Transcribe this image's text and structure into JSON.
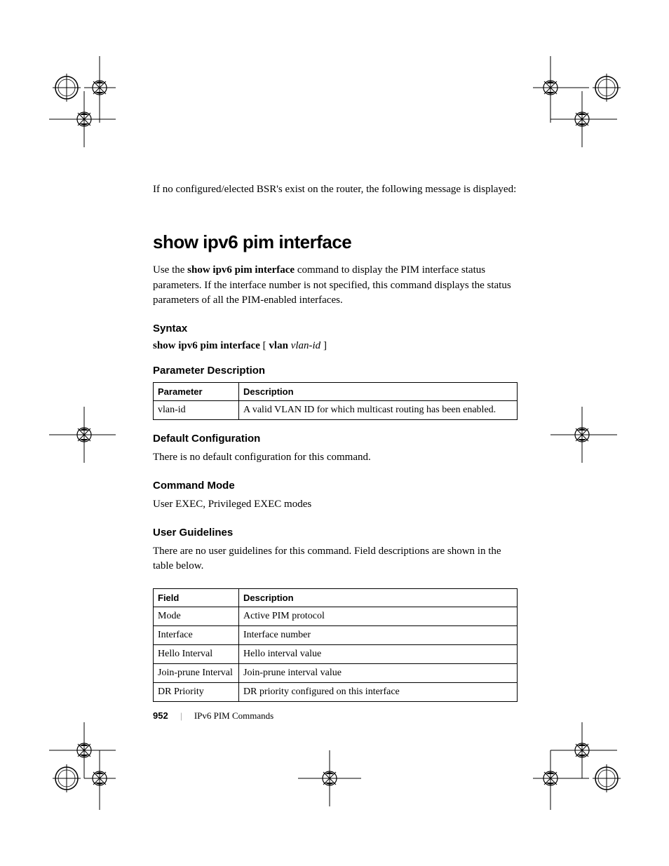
{
  "intro": "If no configured/elected BSR's exist on the router, the following message is displayed:",
  "h1": "show ipv6 pim interface",
  "desc_prefix": "Use the ",
  "desc_cmd": "show ipv6 pim interface",
  "desc_suffix": " command to display the PIM interface status parameters. If the interface number is not specified, this command displays the status parameters of all the PIM-enabled interfaces.",
  "syntax": {
    "heading": "Syntax",
    "cmd": "show ipv6 pim interface",
    "opt_lbr": " [ ",
    "keyword": "vlan",
    "space": " ",
    "arg": "vlan-id",
    "opt_rbr": " ]"
  },
  "param_desc": {
    "heading": "Parameter Description",
    "headers": {
      "p": "Parameter",
      "d": "Description"
    },
    "rows": [
      {
        "p": "vlan-id",
        "d": "A valid VLAN ID for which multicast routing has been enabled."
      }
    ]
  },
  "default_cfg": {
    "heading": "Default Configuration",
    "text": "There is no default configuration for this command."
  },
  "cmd_mode": {
    "heading": "Command Mode",
    "text": "User EXEC, Privileged EXEC modes"
  },
  "user_guidelines": {
    "heading": "User Guidelines",
    "text": "There are no user guidelines for this command. Field descriptions are shown in the table below."
  },
  "fields_table": {
    "headers": {
      "f": "Field",
      "d": "Description"
    },
    "rows": [
      {
        "f": "Mode",
        "d": "Active PIM protocol"
      },
      {
        "f": "Interface",
        "d": "Interface number"
      },
      {
        "f": "Hello Interval",
        "d": "Hello interval value"
      },
      {
        "f": "Join-prune Interval",
        "d": "Join-prune interval value"
      },
      {
        "f": "DR Priority",
        "d": "DR priority configured on this interface"
      }
    ]
  },
  "footer": {
    "page": "952",
    "section": "IPv6 PIM Commands"
  }
}
